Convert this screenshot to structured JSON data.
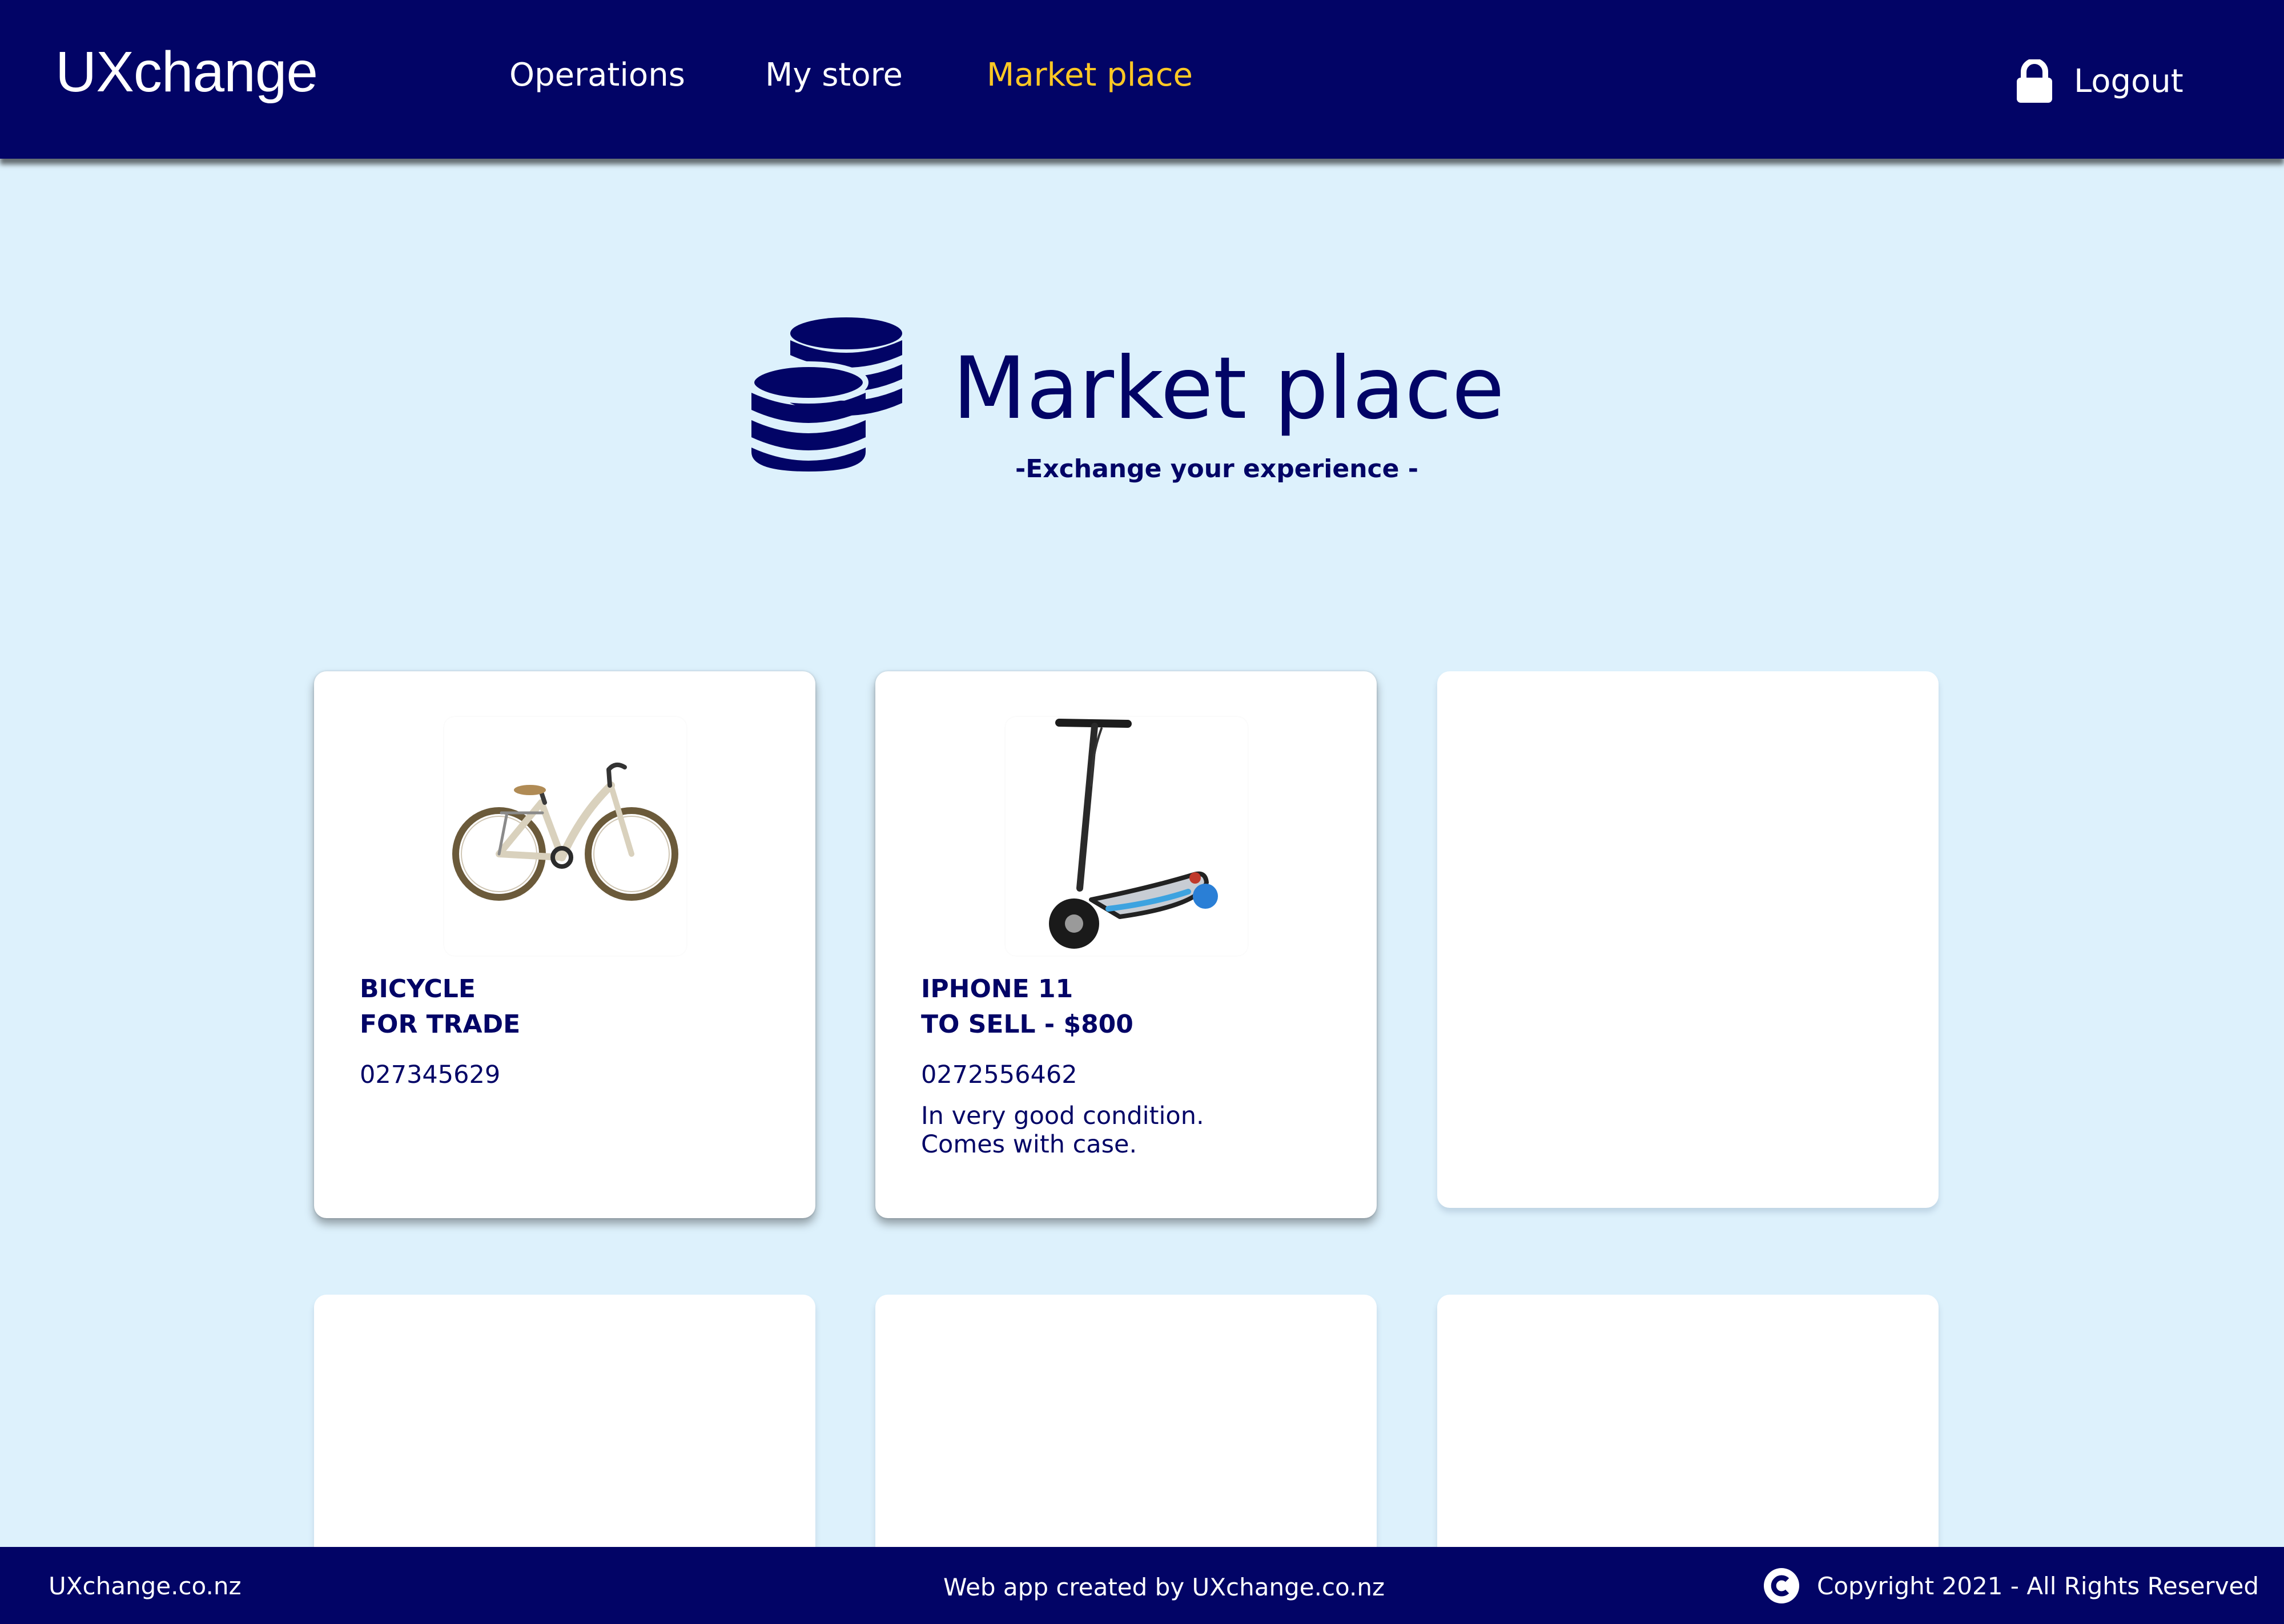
{
  "header": {
    "brand": "UXchange",
    "nav": [
      {
        "label": "Operations",
        "active": false
      },
      {
        "label": "My store",
        "active": false
      },
      {
        "label": "Market place",
        "active": true
      }
    ],
    "logout_label": "Logout",
    "logout_icon": "lock-icon"
  },
  "hero": {
    "icon": "coins-icon",
    "title": "Market place",
    "subtitle": "-Exchange your experience -"
  },
  "listings": [
    {
      "image": "bicycle",
      "title_line1": "BICYCLE",
      "title_line2": "FOR TRADE",
      "phone": "027345629",
      "description_line1": "",
      "description_line2": ""
    },
    {
      "image": "electric-scooter",
      "title_line1": "IPHONE 11",
      "title_line2": "TO SELL - $800",
      "phone": "0272556462",
      "description_line1": "In very good condition.",
      "description_line2": "Comes with case."
    }
  ],
  "footer": {
    "site": "UXchange.co.nz",
    "credit": "Web app created by UXchange.co.nz",
    "copyright": "Copyright 2021 - All Rights Reserved",
    "copyright_icon": "copyright-icon"
  },
  "colors": {
    "navy": "#020466",
    "page_background": "#ddf1fc",
    "active_nav": "#ffc824",
    "card": "#ffffff"
  }
}
